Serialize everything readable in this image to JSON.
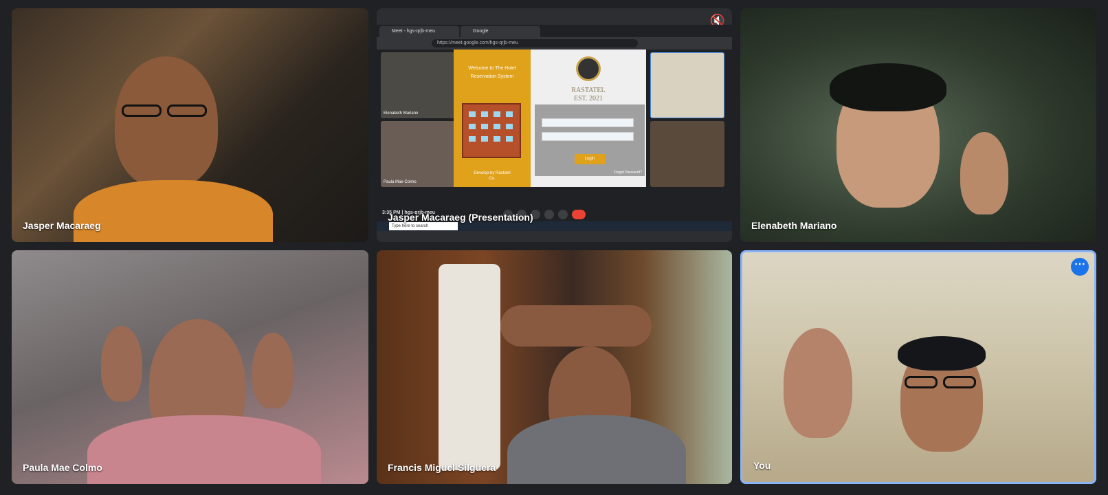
{
  "participants": [
    {
      "name": "Jasper Macaraeg"
    },
    {
      "name": "Jasper Macaraeg (Presentation)"
    },
    {
      "name": "Elenabeth Mariano"
    },
    {
      "name": "Paula Mae Colmo"
    },
    {
      "name": "Francis Miguel Silguera"
    },
    {
      "name": "You"
    }
  ],
  "presentation": {
    "tabs": [
      "Meet - hgs-qrjb-meu",
      "Google"
    ],
    "url": "https://meet.google.com/hgs-qrjb-meu",
    "mini_tiles": [
      "Elenabeth Mariano",
      "Paula Mae Colmo"
    ],
    "dialog": {
      "welcome": "Welcome to The Hotel Reservation System",
      "brand": "RASTATEL",
      "est": "EST. 2021",
      "login_label": "Login",
      "forgot": "Forgot Password?",
      "footer": "Develop by Raststel Co."
    },
    "meet_bar": {
      "time": "3:35 PM",
      "code": "hgs-qrjb-meu"
    },
    "taskbar_search": "Type here to search"
  },
  "icons": {
    "mute": "muted-speaker-icon",
    "more": "more-options-icon"
  },
  "colors": {
    "background": "#202124",
    "active_border": "#8ab4f8",
    "accent": "#1a73e8",
    "hang_up": "#ea4335",
    "dialog_gold": "#e0a21b"
  }
}
